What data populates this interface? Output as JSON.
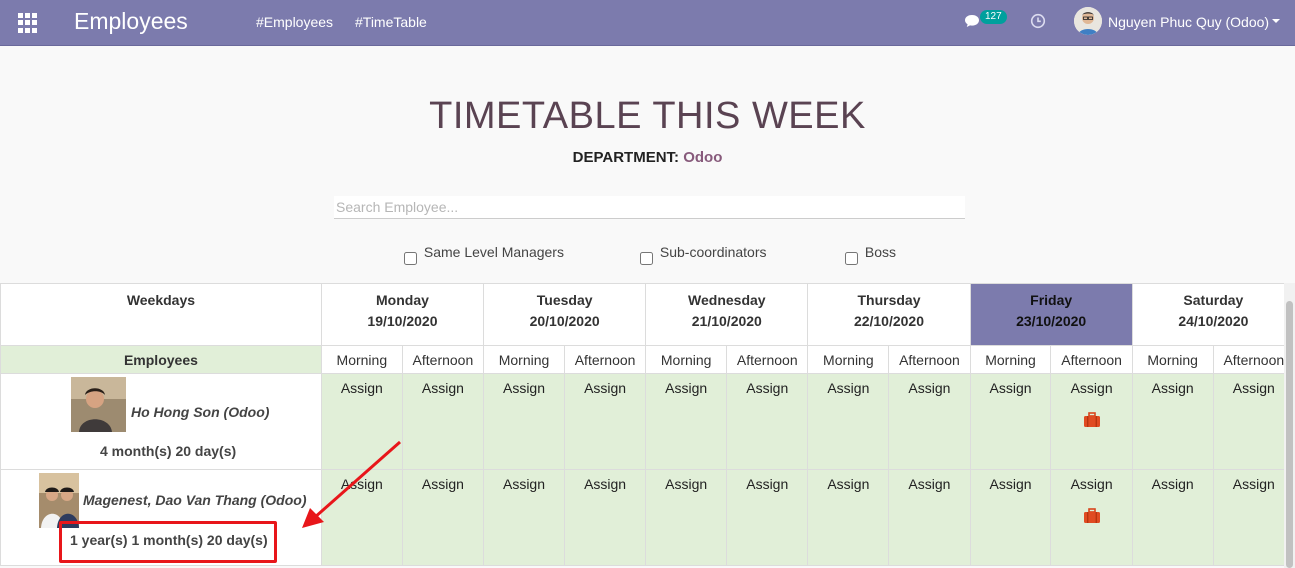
{
  "navbar": {
    "app_title": "Employees",
    "menu": [
      "#Employees",
      "#TimeTable"
    ],
    "chat_count": "127",
    "user_name": "Nguyen Phuc Quy (Odoo)",
    "accent_color": "#7c7bad"
  },
  "header": {
    "title": "TIMETABLE THIS WEEK",
    "department_label": "DEPARTMENT:",
    "department_value": "Odoo"
  },
  "search": {
    "placeholder": "Search Employee...",
    "value": ""
  },
  "filters": [
    {
      "label": "Same Level Managers",
      "checked": false
    },
    {
      "label": "Sub-coordinators",
      "checked": false
    },
    {
      "label": "Boss",
      "checked": false
    }
  ],
  "table": {
    "weekdays_label": "Weekdays",
    "employees_label": "Employees",
    "days": [
      {
        "name": "Monday",
        "date": "19/10/2020",
        "today": false
      },
      {
        "name": "Tuesday",
        "date": "20/10/2020",
        "today": false
      },
      {
        "name": "Wednesday",
        "date": "21/10/2020",
        "today": false
      },
      {
        "name": "Thursday",
        "date": "22/10/2020",
        "today": false
      },
      {
        "name": "Friday",
        "date": "23/10/2020",
        "today": true
      },
      {
        "name": "Saturday",
        "date": "24/10/2020",
        "today": false
      }
    ],
    "shifts": [
      "Morning",
      "Afternoon"
    ],
    "assign_label": "Assign",
    "employees": [
      {
        "name": "Ho Hong Son (Odoo)",
        "tenure": "4 month(s) 20 day(s)",
        "leave_icon_slot": "Friday Afternoon"
      },
      {
        "name": "Magenest, Dao Van Thang (Odoo)",
        "tenure": "1 year(s) 1 month(s) 20 day(s)",
        "leave_icon_slot": "Friday Afternoon"
      }
    ]
  },
  "icons": [
    "apps-grid-icon",
    "chat-icon",
    "clock-icon",
    "caret-down-icon",
    "briefcase-icon"
  ],
  "annotation": {
    "color": "#e8161a",
    "target": "tenure of second employee"
  }
}
